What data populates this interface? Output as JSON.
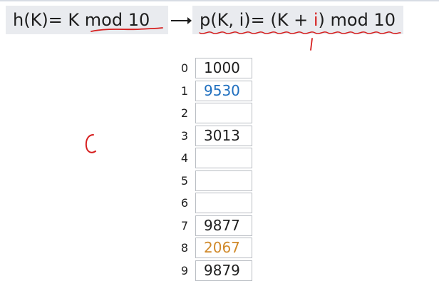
{
  "formula": {
    "hash": "h(K)= K mod 10",
    "probe_prefix": "p(K, i)= (K + ",
    "probe_i": "i",
    "probe_suffix": ") mod 10"
  },
  "table": {
    "rows": [
      {
        "index": "0",
        "value": "1000"
      },
      {
        "index": "1",
        "value": "9530"
      },
      {
        "index": "2",
        "value": ""
      },
      {
        "index": "3",
        "value": "3013"
      },
      {
        "index": "4",
        "value": ""
      },
      {
        "index": "5",
        "value": ""
      },
      {
        "index": "6",
        "value": ""
      },
      {
        "index": "7",
        "value": "9877"
      },
      {
        "index": "8",
        "value": "2067"
      },
      {
        "index": "9",
        "value": "9879"
      }
    ]
  },
  "colors": {
    "ink_red": "#d61f1f",
    "blue_value": "#1f6fbf",
    "orange_value": "#d0892a",
    "formula_bg": "#e9ebef"
  }
}
